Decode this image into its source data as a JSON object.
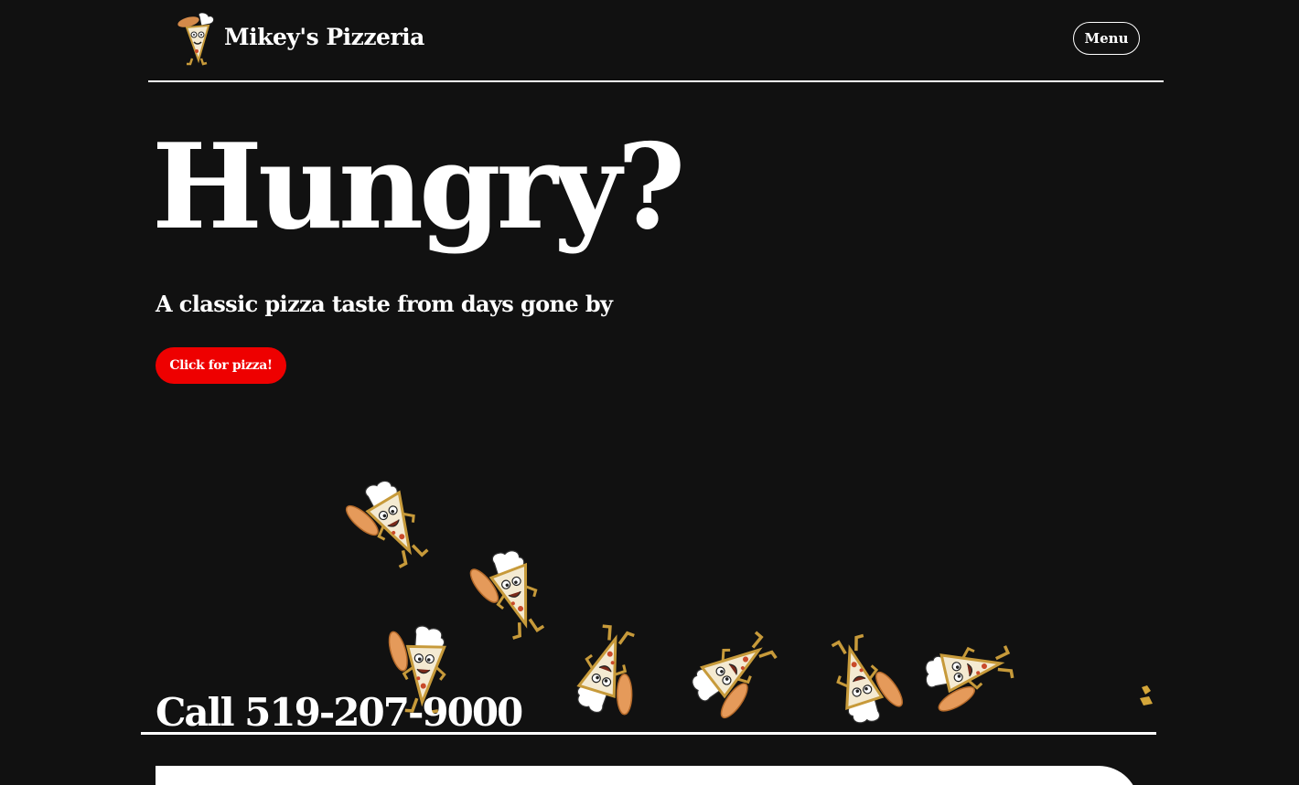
{
  "header": {
    "brand_name": "Mikey's Pizzeria",
    "logo_icon": "pizza-slice-mascot-icon",
    "menu_label": "Menu"
  },
  "hero": {
    "title": "Hungry?",
    "subtitle": "A classic pizza taste from days gone by",
    "cta_label": "Click for pizza!"
  },
  "mascots": {
    "icon": "pizza-slice-chef-mascot-icon",
    "count": 9
  },
  "contact": {
    "call_text": "Call 519-207-9000"
  },
  "colors": {
    "background": "#111111",
    "text": "#ffffff",
    "accent": "#ee0000",
    "crust": "#d4a63a",
    "pizza": "#f4ead2"
  }
}
